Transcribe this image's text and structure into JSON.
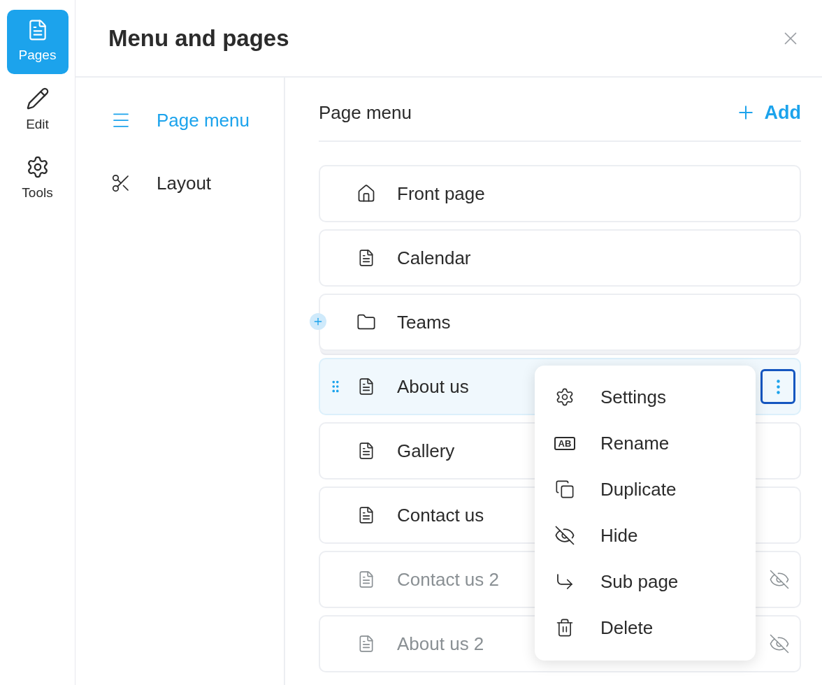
{
  "rail": [
    {
      "label": "Pages",
      "kind": "page",
      "selected": true
    },
    {
      "label": "Edit",
      "kind": "pencil",
      "selected": false
    },
    {
      "label": "Tools",
      "kind": "gear",
      "selected": false
    }
  ],
  "header": {
    "title": "Menu and pages"
  },
  "nav": [
    {
      "label": "Page menu",
      "kind": "menu",
      "selected": true
    },
    {
      "label": "Layout",
      "kind": "scissors",
      "selected": false
    }
  ],
  "panel": {
    "title": "Page menu",
    "add_label": "Add"
  },
  "pages": [
    {
      "label": "Front page",
      "kind": "home",
      "hidden": false,
      "selected": false
    },
    {
      "label": "Calendar",
      "kind": "page",
      "hidden": false,
      "selected": false
    },
    {
      "label": "Teams",
      "kind": "folder",
      "hidden": false,
      "selected": false
    },
    {
      "label": "About us",
      "kind": "page",
      "hidden": false,
      "selected": true
    },
    {
      "label": "Gallery",
      "kind": "page",
      "hidden": false,
      "selected": false
    },
    {
      "label": "Contact us",
      "kind": "page",
      "hidden": false,
      "selected": false
    },
    {
      "label": "Contact us 2",
      "kind": "page",
      "hidden": true,
      "selected": false
    },
    {
      "label": "About us 2",
      "kind": "page",
      "hidden": true,
      "selected": false
    }
  ],
  "context_menu": [
    {
      "label": "Settings",
      "kind": "gear"
    },
    {
      "label": "Rename",
      "kind": "rename",
      "icon_text": "AB"
    },
    {
      "label": "Duplicate",
      "kind": "copy"
    },
    {
      "label": "Hide",
      "kind": "eyeoff"
    },
    {
      "label": "Sub page",
      "kind": "subpage"
    },
    {
      "label": "Delete",
      "kind": "trash"
    }
  ]
}
